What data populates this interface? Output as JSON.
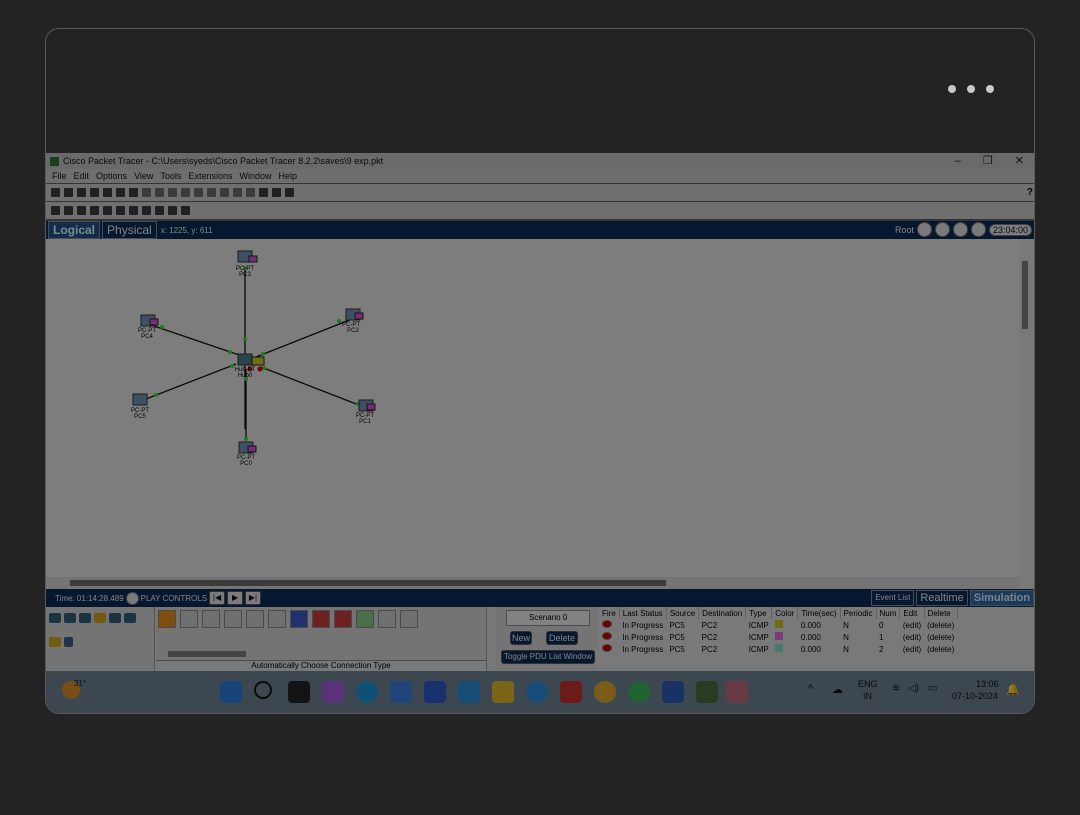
{
  "window": {
    "title": "Cisco Packet Tracer - C:\\Users\\syeds\\Cisco Packet Tracer 8.2.2\\saves\\9 exp.pkt",
    "minimize": "–",
    "restore": "❐",
    "close": "✕"
  },
  "menu": [
    "File",
    "Edit",
    "Options",
    "View",
    "Tools",
    "Extensions",
    "Window",
    "Help"
  ],
  "help_button": "?",
  "view_bar": {
    "logical_tab": "Logical",
    "physical_tab": "Physical",
    "coords": "x: 1225, y: 611",
    "root_label": "Root",
    "clock": "23:04:00"
  },
  "devices": [
    {
      "type": "PC-PT",
      "name": "PC3"
    },
    {
      "type": "PC-PT",
      "name": "PC4"
    },
    {
      "type": "PC-PT",
      "name": "PC2"
    },
    {
      "type": "Hub-PT",
      "name": "Hub0"
    },
    {
      "type": "PC-PT",
      "name": "PC5"
    },
    {
      "type": "PC-PT",
      "name": "PC1"
    },
    {
      "type": "PC-PT",
      "name": "PC0"
    }
  ],
  "sim_bar": {
    "time": "Time: 01:14:28.489",
    "play_controls": "PLAY CONTROLS",
    "event_list": "Event List",
    "realtime": "Realtime",
    "simulation": "Simulation"
  },
  "connections_label": "Automatically Choose Connection Type",
  "scenario": {
    "selected": "Scenario 0",
    "new_label": "New",
    "delete_label": "Delete",
    "toggle_label": "Toggle PDU List Window"
  },
  "pdu_table": {
    "headers": [
      "Fire",
      "Last Status",
      "Source",
      "Destination",
      "Type",
      "Color",
      "Time(sec)",
      "Periodic",
      "Num",
      "Edit",
      "Delete"
    ],
    "rows": [
      {
        "status": "In Progress",
        "source": "PC5",
        "destination": "PC2",
        "type": "ICMP",
        "color": "#c9c21c",
        "time": "0.000",
        "periodic": "N",
        "num": "0",
        "edit": "(edit)",
        "delete": "(delete)"
      },
      {
        "status": "In Progress",
        "source": "PC5",
        "destination": "PC2",
        "type": "ICMP",
        "color": "#d96ad9",
        "time": "0.000",
        "periodic": "N",
        "num": "1",
        "edit": "(edit)",
        "delete": "(delete)"
      },
      {
        "status": "In Progress",
        "source": "PC5",
        "destination": "PC2",
        "type": "ICMP",
        "color": "#7ad9c4",
        "time": "0.000",
        "periodic": "N",
        "num": "2",
        "edit": "(edit)",
        "delete": "(delete)"
      }
    ]
  },
  "taskbar": {
    "weather": "31°",
    "lang_line1": "ENG",
    "lang_line2": "IN",
    "time": "13:06",
    "date": "07-10-2024"
  }
}
